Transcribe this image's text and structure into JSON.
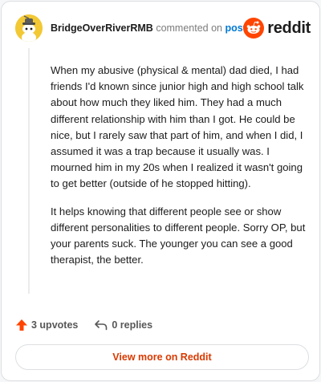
{
  "comment": {
    "username": "BridgeOverRiverRMB",
    "action_text": "commented on",
    "post_link": "post",
    "paragraphs": [
      "When my abusive (physical & mental) dad died, I had friends I'd known since junior high and high school talk about how much they liked him. They had a much different relationship with him than I got. He could be nice, but I rarely saw that part of him, and when I did, I assumed it was a trap because it usually was. I mourned him in my 20s when I realized it wasn't going to get better (outside of he stopped hitting).",
      "It helps knowing that different people see or show different personalities to different people. Sorry OP, but your parents suck. The younger you can see a good therapist, the better."
    ]
  },
  "brand": {
    "name": "reddit",
    "color": "#ff4500"
  },
  "actions": {
    "upvotes": "3 upvotes",
    "replies": "0 replies"
  },
  "view_more": "View more on Reddit",
  "colors": {
    "upvote": "#ff4500",
    "link": "#0079d3",
    "view_more": "#d93a00",
    "avatar_bg": "#f2c834"
  },
  "icons": {
    "avatar": "snoo-avatar-icon",
    "brand": "reddit-logo-icon",
    "upvote": "upvote-arrow-icon",
    "reply": "reply-arrow-icon"
  }
}
